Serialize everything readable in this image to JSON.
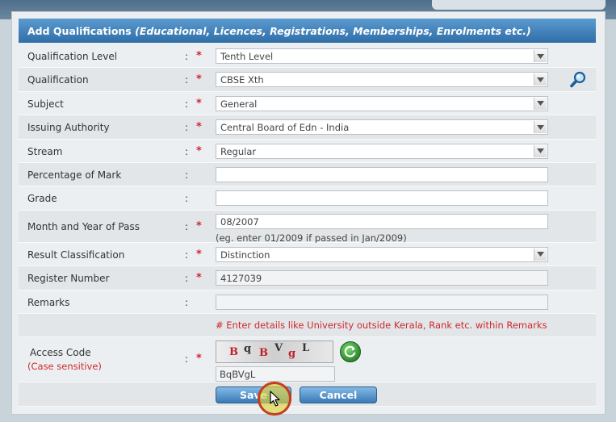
{
  "header": {
    "title": "Add Qualifications",
    "subtitle": "(Educational, Licences, Registrations, Memberships, Enrolments etc.)"
  },
  "fields": {
    "qualification_level": {
      "label": "Qualification Level",
      "value": "Tenth Level",
      "required": true
    },
    "qualification": {
      "label": "Qualification",
      "value": "CBSE Xth",
      "required": true
    },
    "subject": {
      "label": "Subject",
      "value": "General",
      "required": true
    },
    "issuing_authority": {
      "label": "Issuing Authority",
      "value": "Central Board of Edn - India",
      "required": true
    },
    "stream": {
      "label": "Stream",
      "value": "Regular",
      "required": true
    },
    "percentage": {
      "label": "Percentage of Mark",
      "value": "",
      "required": false
    },
    "grade": {
      "label": "Grade",
      "value": "",
      "required": false
    },
    "month_year": {
      "label": "Month and Year of Pass",
      "value": "08/2007",
      "required": true,
      "hint": "(eg. enter 01/2009 if passed in Jan/2009)"
    },
    "result_classification": {
      "label": "Result Classification",
      "value": "Distinction",
      "required": true
    },
    "register_number": {
      "label": "Register Number",
      "value": "4127039",
      "required": true
    },
    "remarks": {
      "label": "Remarks",
      "value": "",
      "required": false
    }
  },
  "colon": ":",
  "required_mark": "*",
  "remarks_note": "# Enter details like University outside Kerala, Rank etc. within Remarks",
  "access_code": {
    "label": "Access Code",
    "sub_label": "(Case sensitive)",
    "captcha_chars": [
      "B",
      "q",
      "B",
      "V",
      "g",
      "L"
    ],
    "value": "BqBVgL"
  },
  "buttons": {
    "save": "Save",
    "cancel": "Cancel"
  },
  "colors": {
    "header": "#2f6ea6",
    "required": "#d0282c",
    "button": "#3a7ab6",
    "captcha_text": "#c0202a"
  },
  "icons": {
    "search": "magnifier-icon",
    "refresh": "refresh-icon",
    "dropdown": "chevron-down-icon",
    "cursor": "mouse-pointer-icon"
  }
}
